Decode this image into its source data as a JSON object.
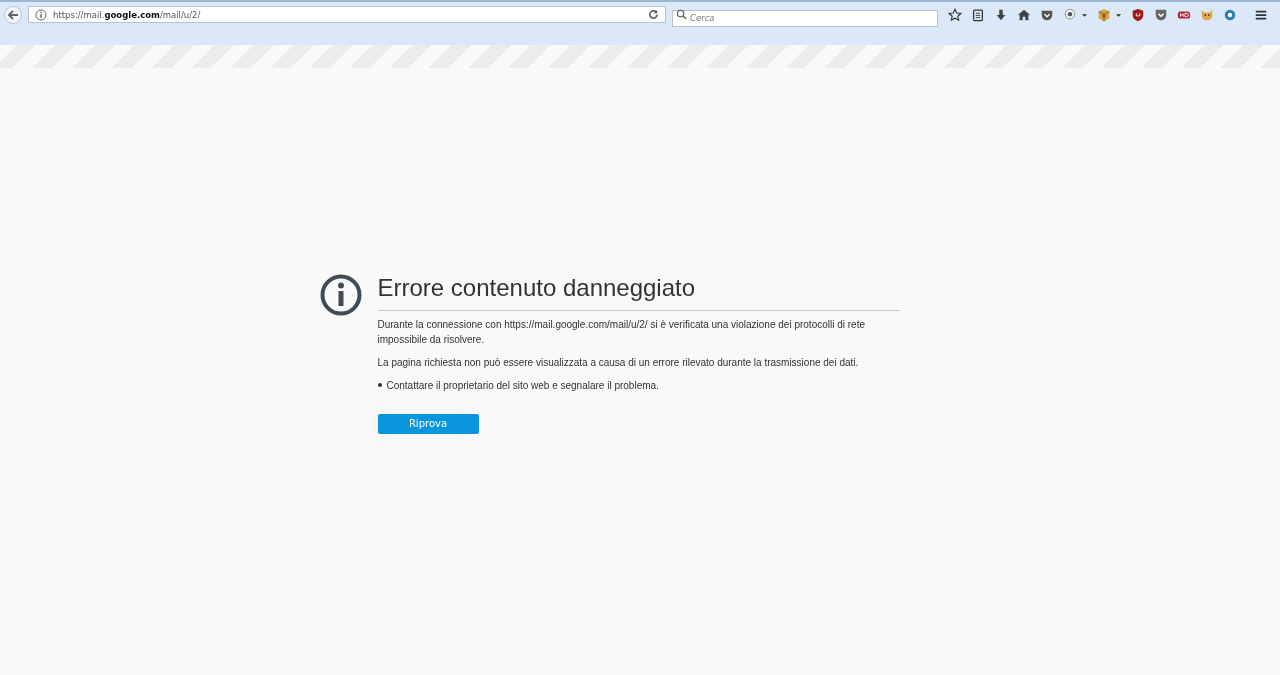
{
  "toolbar": {
    "url": "https://mail.**google.com**/mail/u/2/",
    "search": {
      "placeholder": "Cerca"
    },
    "icons": [
      {
        "kind": "star"
      },
      {
        "kind": "list"
      },
      {
        "kind": "download"
      },
      {
        "kind": "home"
      },
      {
        "kind": "pocket"
      },
      {
        "kind": "speech"
      },
      {
        "kind": "caret"
      },
      {
        "kind": "cube"
      },
      {
        "kind": "caret"
      },
      {
        "kind": "shield"
      },
      {
        "kind": "pocket-gray"
      },
      {
        "kind": "hd"
      },
      {
        "kind": "cat"
      },
      {
        "kind": "globe"
      },
      {
        "kind": "menu"
      }
    ]
  },
  "error": {
    "title": "Errore contenuto danneggiato",
    "paragraphs": [
      "Durante la connessione con https://mail.google.com/mail/u/2/ si è verificata una violazione dei protocolli di rete impossibile da risolvere.",
      "La pagina richiesta non può essere visualizzata a causa di un errore rilevato durante la trasmissione dei dati."
    ],
    "bullets": [
      "Contattare il proprietario del sito web e segnalare il problema."
    ],
    "button": "Riprova"
  }
}
